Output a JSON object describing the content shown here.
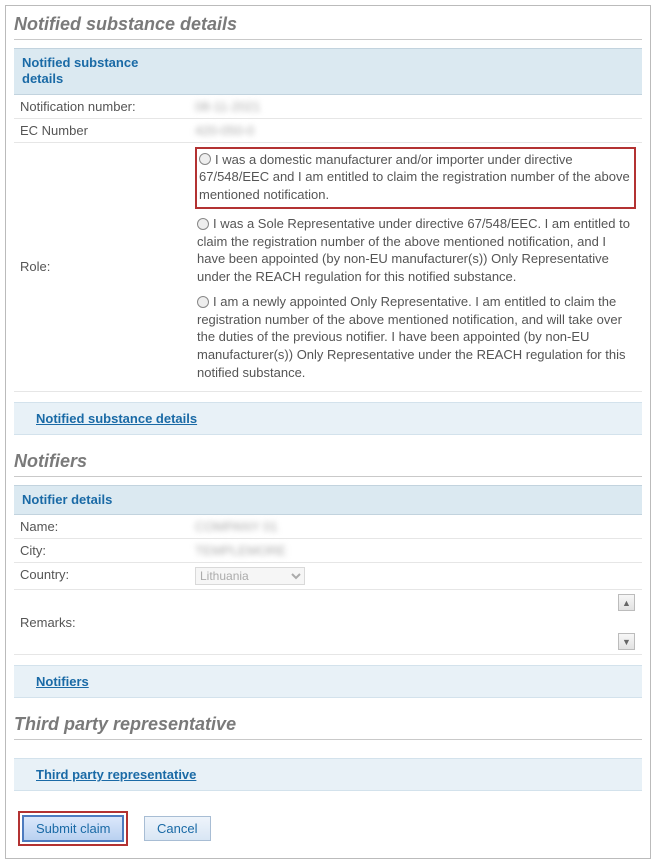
{
  "section1": {
    "title": "Notified substance details",
    "header": "Notified substance details",
    "fields": {
      "notification_label": "Notification number:",
      "notification_value": "08-11-2021",
      "ec_label": "EC Number",
      "ec_value": "420-050-0",
      "role_label": "Role:"
    },
    "roles": {
      "opt1": "I was a domestic manufacturer and/or importer under directive 67/548/EEC and I am entitled to claim the registration number of the above mentioned notification.",
      "opt2": "I was a Sole Representative under directive 67/548/EEC. I am entitled to claim the registration number of the above mentioned notification, and I have been appointed (by non-EU manufacturer(s)) Only Representative under the REACH regulation for this notified substance.",
      "opt3": "I am a newly appointed Only Representative. I am entitled to claim the registration number of the above mentioned notification, and will take over the duties of the previous notifier. I have been appointed (by non-EU manufacturer(s)) Only Representative under the REACH regulation for this notified substance."
    },
    "link": "Notified substance details"
  },
  "section2": {
    "title": "Notifiers",
    "header": "Notifier details",
    "fields": {
      "name_label": "Name:",
      "name_value": "COMPANY 01",
      "city_label": "City:",
      "city_value": "TEMPLEMORE",
      "country_label": "Country:",
      "country_value": "Lithuania",
      "remarks_label": "Remarks:"
    },
    "link": "Notifiers"
  },
  "section3": {
    "title": "Third party representative",
    "link": "Third party representative"
  },
  "buttons": {
    "submit": "Submit claim",
    "cancel": "Cancel"
  }
}
